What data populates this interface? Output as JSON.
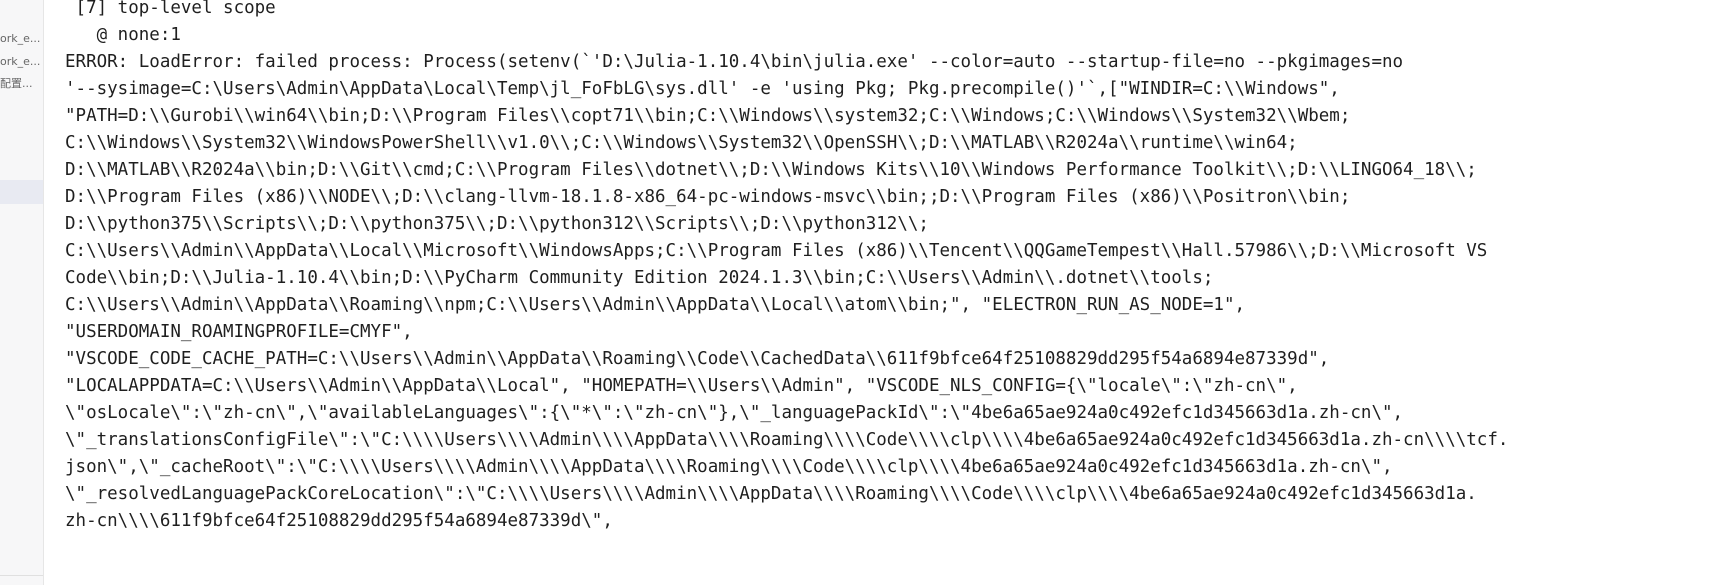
{
  "sidebar": {
    "items": [
      {
        "label": "ork_e..."
      },
      {
        "label": "ork_e..."
      },
      {
        "label": "配置..."
      }
    ]
  },
  "console": {
    "lines": [
      " [7] top-level scope",
      "   @ none:1",
      "ERROR: LoadError: failed process: Process(setenv(`'D:\\Julia-1.10.4\\bin\\julia.exe' --color=auto --startup-file=no --pkgimages=no",
      "'--sysimage=C:\\Users\\Admin\\AppData\\Local\\Temp\\jl_FoFbLG\\sys.dll' -e 'using Pkg; Pkg.precompile()'`,[\"WINDIR=C:\\\\Windows\",",
      "\"PATH=D:\\\\Gurobi\\\\win64\\\\bin;D:\\\\Program Files\\\\copt71\\\\bin;C:\\\\Windows\\\\system32;C:\\\\Windows;C:\\\\Windows\\\\System32\\\\Wbem;",
      "C:\\\\Windows\\\\System32\\\\WindowsPowerShell\\\\v1.0\\\\;C:\\\\Windows\\\\System32\\\\OpenSSH\\\\;D:\\\\MATLAB\\\\R2024a\\\\runtime\\\\win64;",
      "D:\\\\MATLAB\\\\R2024a\\\\bin;D:\\\\Git\\\\cmd;C:\\\\Program Files\\\\dotnet\\\\;D:\\\\Windows Kits\\\\10\\\\Windows Performance Toolkit\\\\;D:\\\\LINGO64_18\\\\;",
      "D:\\\\Program Files (x86)\\\\NODE\\\\;D:\\\\clang-llvm-18.1.8-x86_64-pc-windows-msvc\\\\bin;;D:\\\\Program Files (x86)\\\\Positron\\\\bin;",
      "D:\\\\python375\\\\Scripts\\\\;D:\\\\python375\\\\;D:\\\\python312\\\\Scripts\\\\;D:\\\\python312\\\\;",
      "C:\\\\Users\\\\Admin\\\\AppData\\\\Local\\\\Microsoft\\\\WindowsApps;C:\\\\Program Files (x86)\\\\Tencent\\\\QQGameTempest\\\\Hall.57986\\\\;D:\\\\Microsoft VS",
      "Code\\\\bin;D:\\\\Julia-1.10.4\\\\bin;D:\\\\PyCharm Community Edition 2024.1.3\\\\bin;C:\\\\Users\\\\Admin\\\\.dotnet\\\\tools;",
      "C:\\\\Users\\\\Admin\\\\AppData\\\\Roaming\\\\npm;C:\\\\Users\\\\Admin\\\\AppData\\\\Local\\\\atom\\\\bin;\", \"ELECTRON_RUN_AS_NODE=1\",",
      "\"USERDOMAIN_ROAMINGPROFILE=CMYF\",",
      "\"VSCODE_CODE_CACHE_PATH=C:\\\\Users\\\\Admin\\\\AppData\\\\Roaming\\\\Code\\\\CachedData\\\\611f9bfce64f25108829dd295f54a6894e87339d\",",
      "\"LOCALAPPDATA=C:\\\\Users\\\\Admin\\\\AppData\\\\Local\", \"HOMEPATH=\\\\Users\\\\Admin\", \"VSCODE_NLS_CONFIG={\\\"locale\\\":\\\"zh-cn\\\",",
      "\\\"osLocale\\\":\\\"zh-cn\\\",\\\"availableLanguages\\\":{\\\"*\\\":\\\"zh-cn\\\"},\\\"_languagePackId\\\":\\\"4be6a65ae924a0c492efc1d345663d1a.zh-cn\\\",",
      "\\\"_translationsConfigFile\\\":\\\"C:\\\\\\\\Users\\\\\\\\Admin\\\\\\\\AppData\\\\\\\\Roaming\\\\\\\\Code\\\\\\\\clp\\\\\\\\4be6a65ae924a0c492efc1d345663d1a.zh-cn\\\\\\\\tcf.",
      "json\\\",\\\"_cacheRoot\\\":\\\"C:\\\\\\\\Users\\\\\\\\Admin\\\\\\\\AppData\\\\\\\\Roaming\\\\\\\\Code\\\\\\\\clp\\\\\\\\4be6a65ae924a0c492efc1d345663d1a.zh-cn\\\",",
      "\\\"_resolvedLanguagePackCoreLocation\\\":\\\"C:\\\\\\\\Users\\\\\\\\Admin\\\\\\\\AppData\\\\\\\\Roaming\\\\\\\\Code\\\\\\\\clp\\\\\\\\4be6a65ae924a0c492efc1d345663d1a.",
      "zh-cn\\\\\\\\611f9bfce64f25108829dd295f54a6894e87339d\\\","
    ]
  }
}
